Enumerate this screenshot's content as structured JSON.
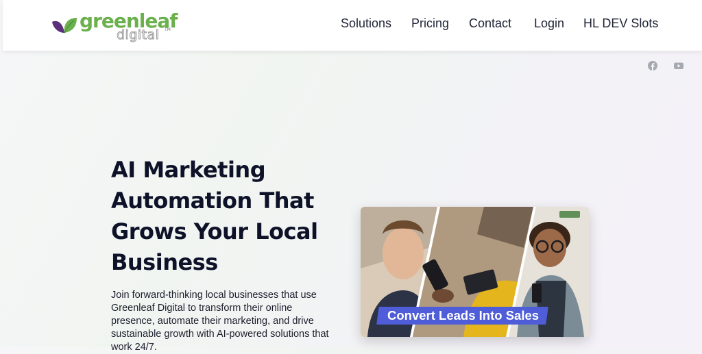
{
  "brand": {
    "name": "greenleaf",
    "subname": "digital",
    "trademark": "TM",
    "colors": {
      "green": "#6ab04c",
      "purple": "#6a3d86",
      "gray": "#9a9a9a"
    }
  },
  "nav": {
    "items": [
      {
        "label": "Solutions"
      },
      {
        "label": "Pricing"
      },
      {
        "label": "Contact"
      },
      {
        "label": "Login"
      },
      {
        "label": "HL DEV Slots"
      }
    ]
  },
  "social": {
    "icons": [
      "facebook-icon",
      "youtube-icon"
    ],
    "color": "#a6a8b2"
  },
  "hero": {
    "title": "AI Marketing Automation That Grows Your Local Business",
    "text": "Join forward-thinking local businesses that use Greenleaf Digital to transform their online presence, automate their marketing, and drive sustainable growth with AI-powered solutions that work 24/7.",
    "card": {
      "caption": "Convert Leads Into Sales",
      "caption_color": "#4f5dd8"
    }
  }
}
